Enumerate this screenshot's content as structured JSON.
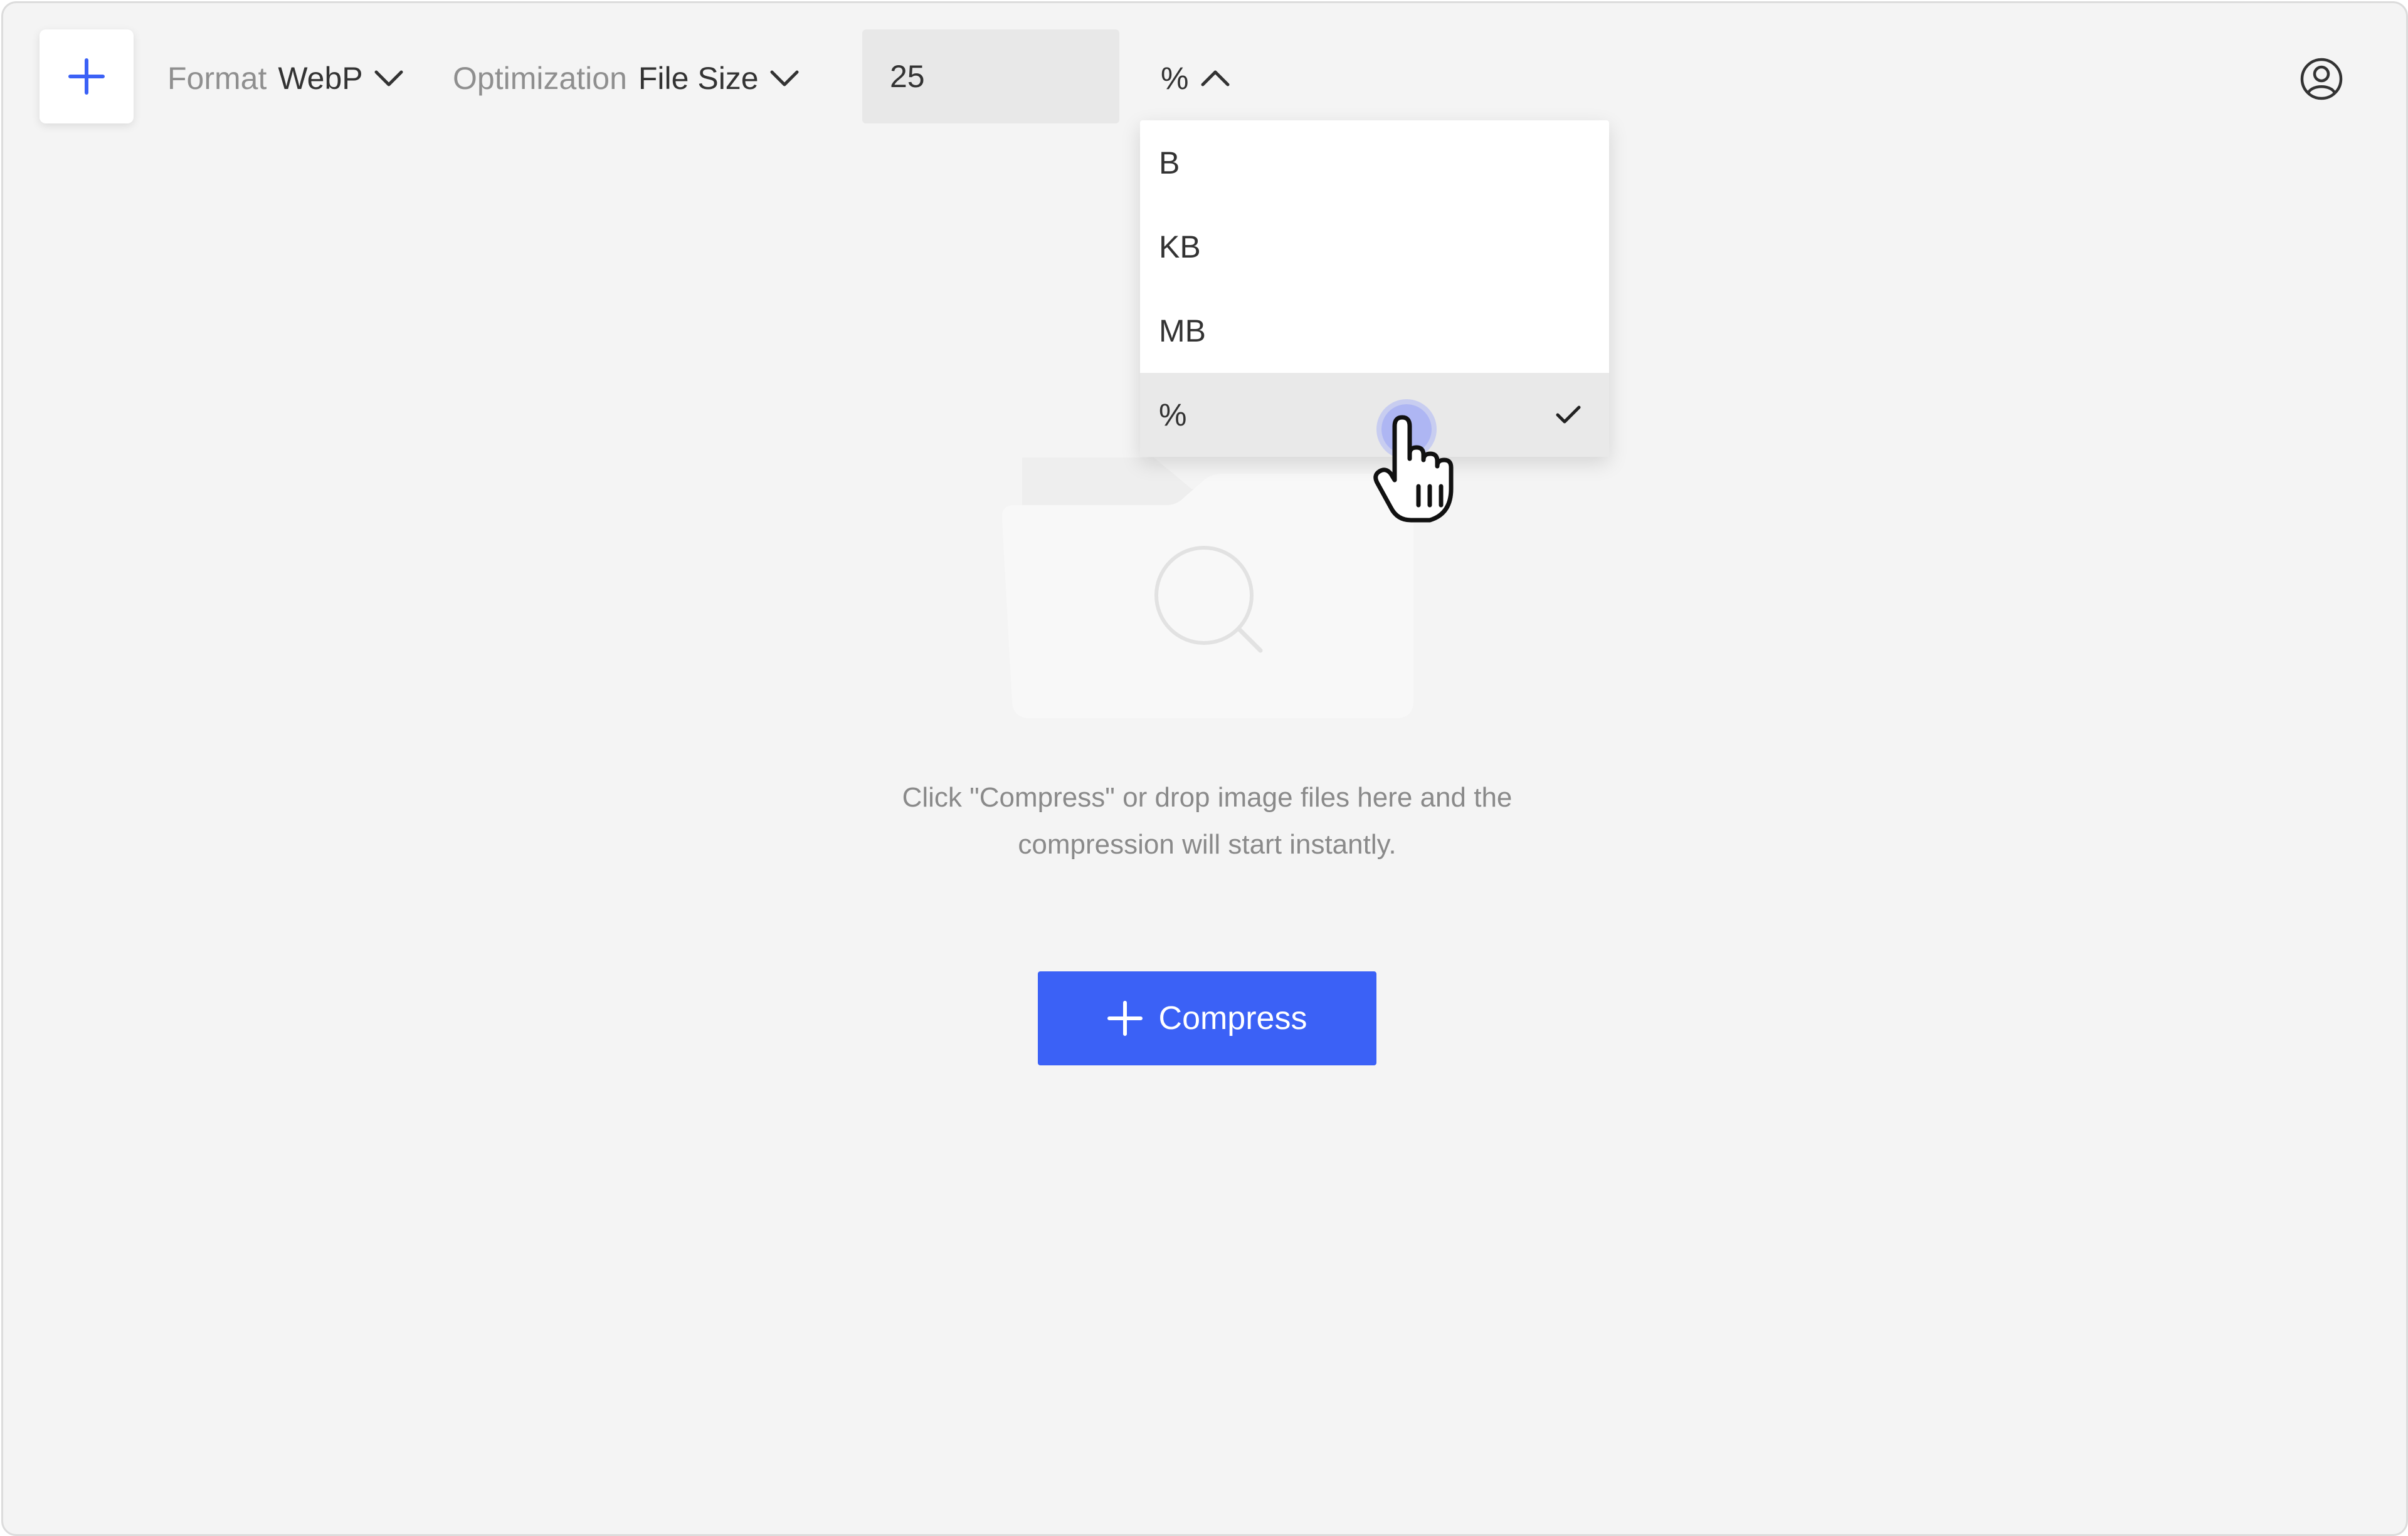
{
  "toolbar": {
    "add_icon": "plus-icon",
    "format_label": "Format",
    "format_value": "WebP",
    "optimization_label": "Optimization",
    "optimization_value": "File Size",
    "size_value": "25",
    "unit_value": "%",
    "account_icon": "user-circle-icon"
  },
  "unit_menu": {
    "expanded": true,
    "options": [
      {
        "label": "B",
        "selected": false
      },
      {
        "label": "KB",
        "selected": false
      },
      {
        "label": "MB",
        "selected": false
      },
      {
        "label": "%",
        "selected": true
      }
    ],
    "check_icon": "checkmark-icon"
  },
  "empty_state": {
    "illustration": "folder-search-illustration",
    "hint_line1": "Click \"Compress\" or drop image files here and the",
    "hint_line2": "compression will start instantly."
  },
  "compress_button": {
    "label": "Compress",
    "icon": "plus-icon"
  },
  "colors": {
    "accent": "#3b61f6",
    "background": "#f4f4f4"
  }
}
